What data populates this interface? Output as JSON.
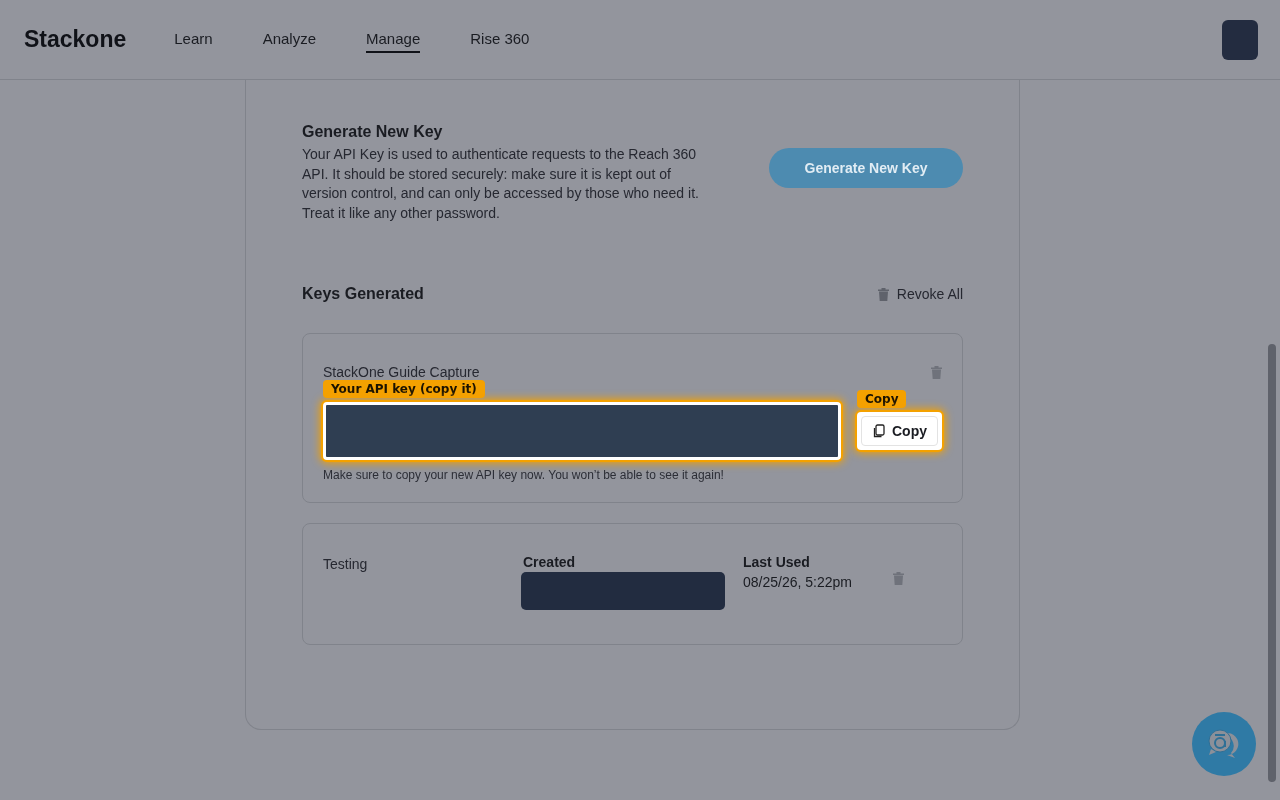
{
  "header": {
    "logo": "Stackone",
    "nav": [
      {
        "label": "Learn",
        "selected": false
      },
      {
        "label": "Analyze",
        "selected": false
      },
      {
        "label": "Manage",
        "selected": true
      },
      {
        "label": "Rise 360",
        "selected": false
      }
    ]
  },
  "generate": {
    "title": "Generate New Key",
    "description": "Your API Key is used to authenticate requests to the Reach 360 API. It should be stored securely: make sure it is kept out of version control, and can only be accessed by those who need it. Treat it like any other password.",
    "button": "Generate New Key"
  },
  "keys": {
    "title": "Keys Generated",
    "revoke_all": "Revoke All",
    "new_key": {
      "name": "StackOne Guide Capture",
      "callout": "Your API key (copy it)",
      "copy_callout": "Copy",
      "copy_button": "Copy",
      "note": "Make sure to copy your new API key now. You won’t be able to see it again!"
    },
    "items": [
      {
        "name": "Testing",
        "created_label": "Created",
        "last_used_label": "Last Used",
        "last_used": "08/25/26, 5:22pm"
      }
    ]
  }
}
